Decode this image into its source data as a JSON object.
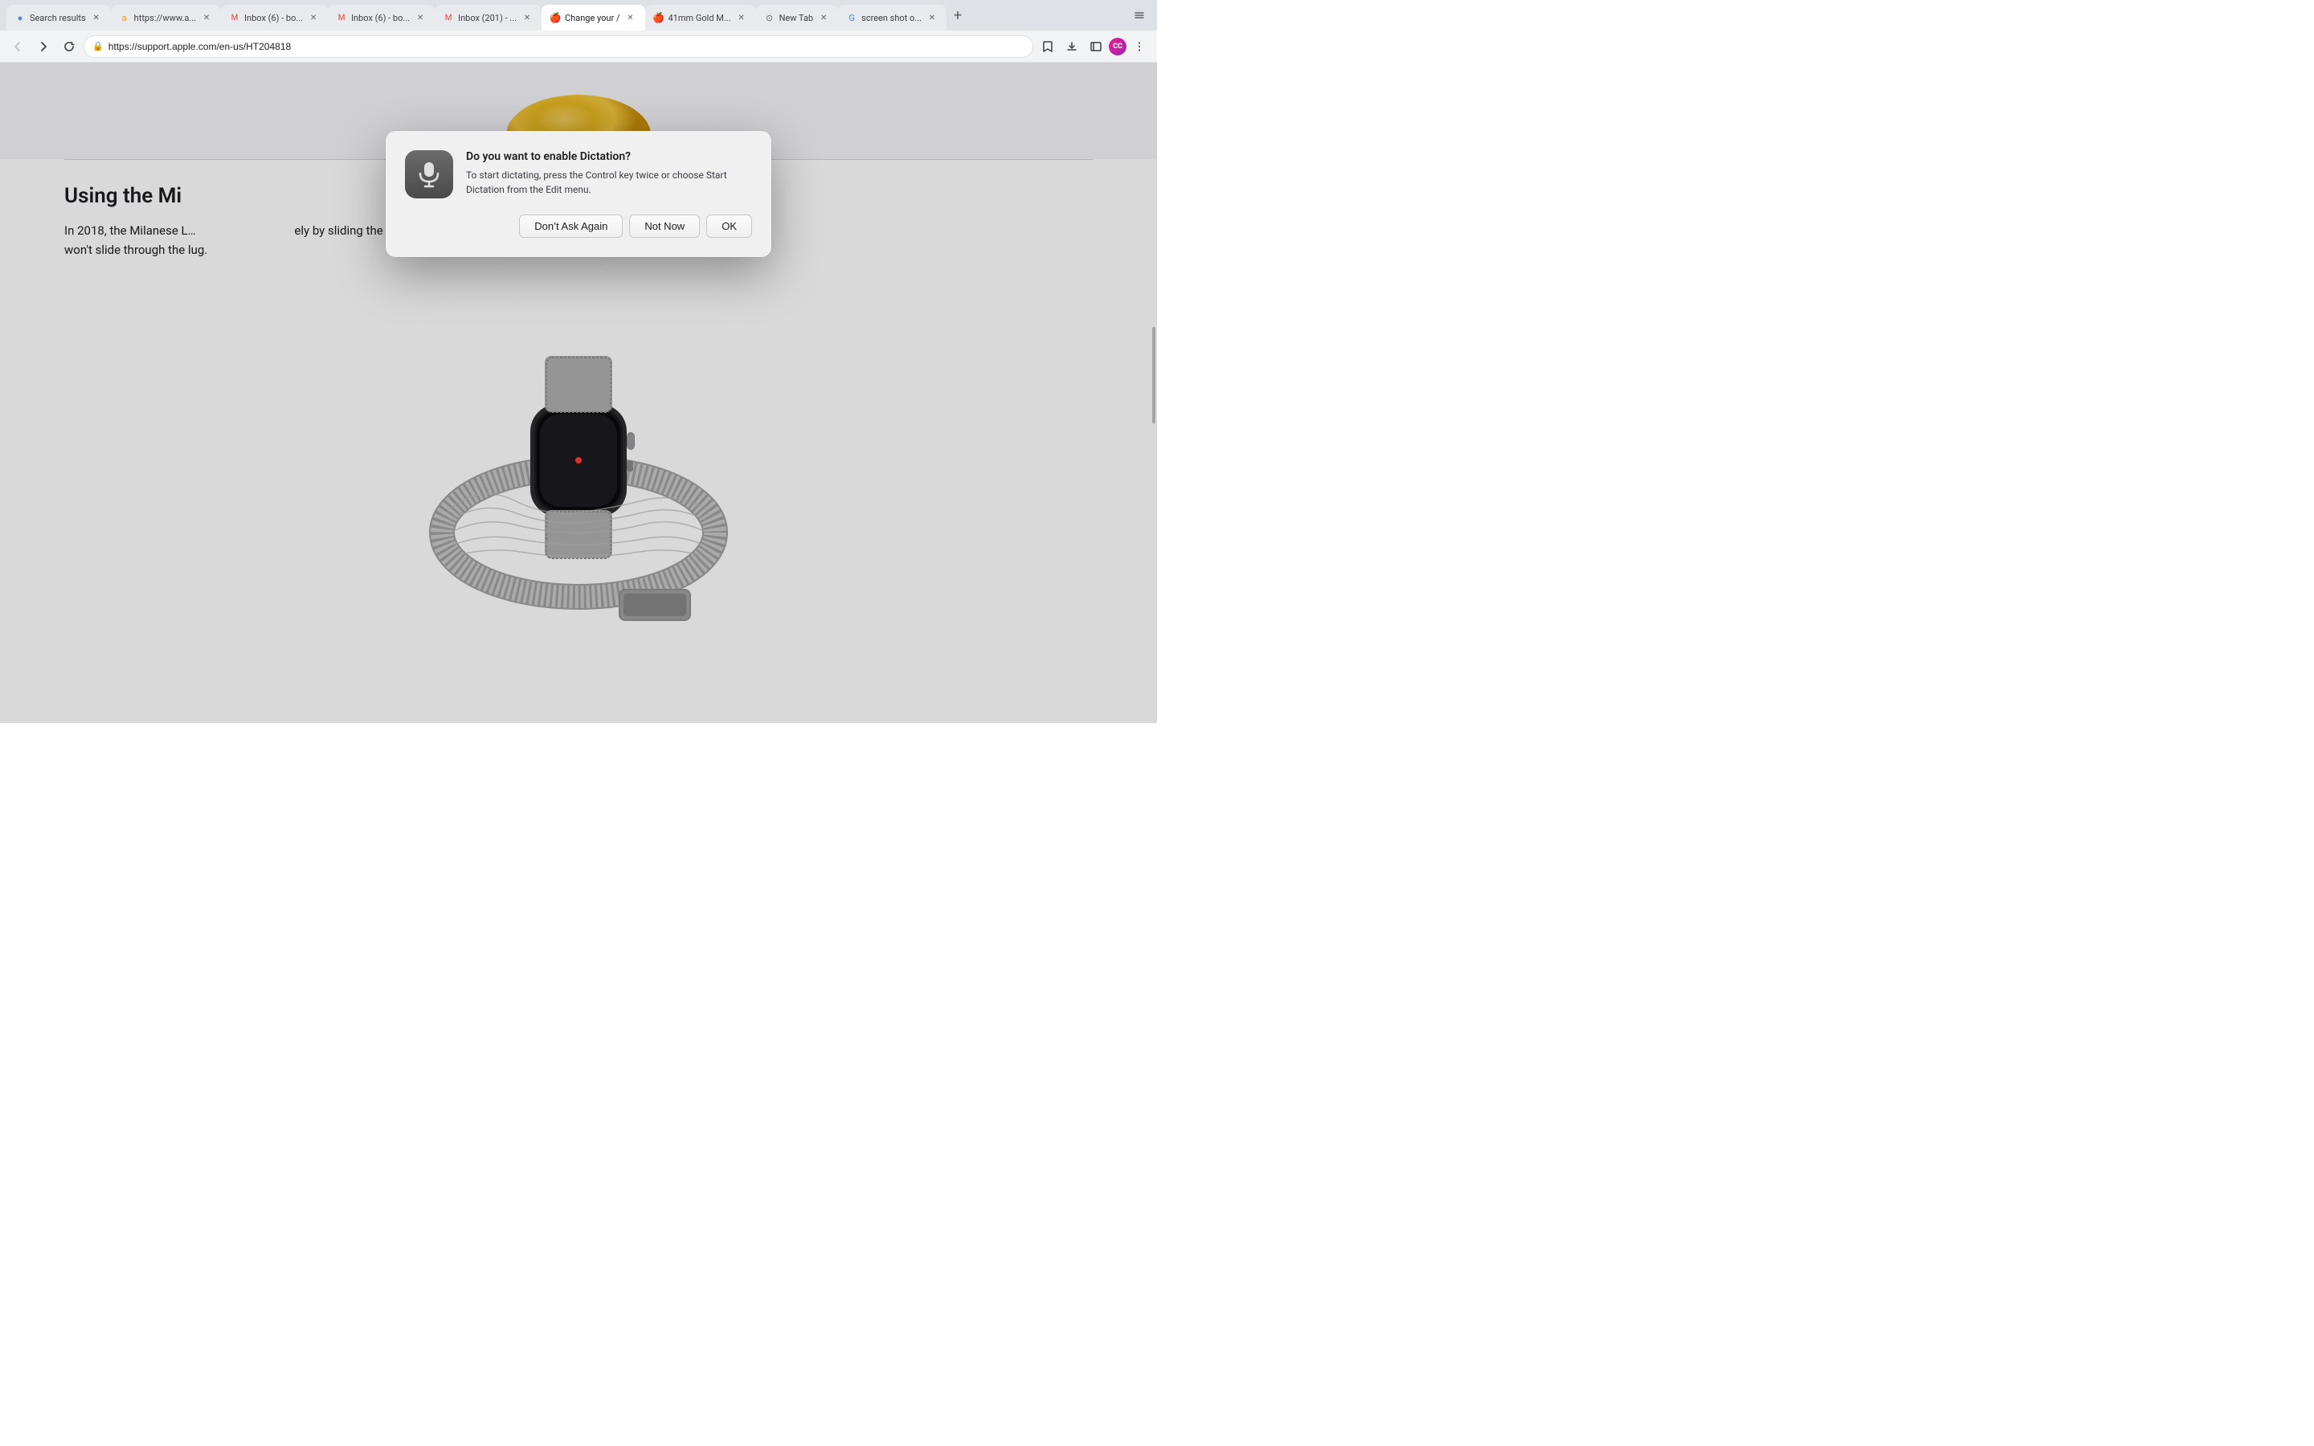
{
  "browser": {
    "tabs": [
      {
        "id": "search-results",
        "title": "Search results",
        "favicon": "🔵",
        "favicon_type": "circle",
        "active": false,
        "url": ""
      },
      {
        "id": "amazon",
        "title": "https://www.a...",
        "favicon": "amazon",
        "active": false,
        "url": ""
      },
      {
        "id": "gmail-1",
        "title": "Inbox (6) - bo...",
        "favicon": "gmail",
        "active": false,
        "url": ""
      },
      {
        "id": "gmail-2",
        "title": "Inbox (6) - bo...",
        "favicon": "gmail",
        "active": false,
        "url": ""
      },
      {
        "id": "gmail-3",
        "title": "Inbox (201) - ...",
        "favicon": "gmail",
        "active": false,
        "url": ""
      },
      {
        "id": "change-your",
        "title": "Change your /",
        "favicon": "apple",
        "active": true,
        "url": ""
      },
      {
        "id": "41mm-gold",
        "title": "41mm Gold M...",
        "favicon": "apple",
        "active": false,
        "url": ""
      },
      {
        "id": "new-tab",
        "title": "New Tab",
        "favicon": "new",
        "active": false,
        "url": ""
      },
      {
        "id": "screenshot",
        "title": "screen shot o...",
        "favicon": "google",
        "active": false,
        "url": ""
      }
    ],
    "address": "https://support.apple.com/en-us/HT204818"
  },
  "page": {
    "top_image_alt": "Watch band clasp image",
    "section_heading": "Using the Mi",
    "section_text": "In 2018, the Milanese Lâ€¦ ely by sliding the magnetic closure throuâ€¦ s, the closure won’t slide through the lug.",
    "full_section_text": "In 2018, the Milanese Loop was updated. You can adjust it easily by sliding the magnetic closure through the band. Unlike previous Milanese Loops, the closure won't slide through the lug."
  },
  "dialog": {
    "title": "Do you want to enable Dictation?",
    "message": "To start dictating, press the Control key twice or choose Start Dictation from the Edit menu.",
    "btn_dont_ask": "Don’t Ask Again",
    "btn_not_now": "Not Now",
    "btn_ok": "OK",
    "icon_alt": "microphone"
  }
}
